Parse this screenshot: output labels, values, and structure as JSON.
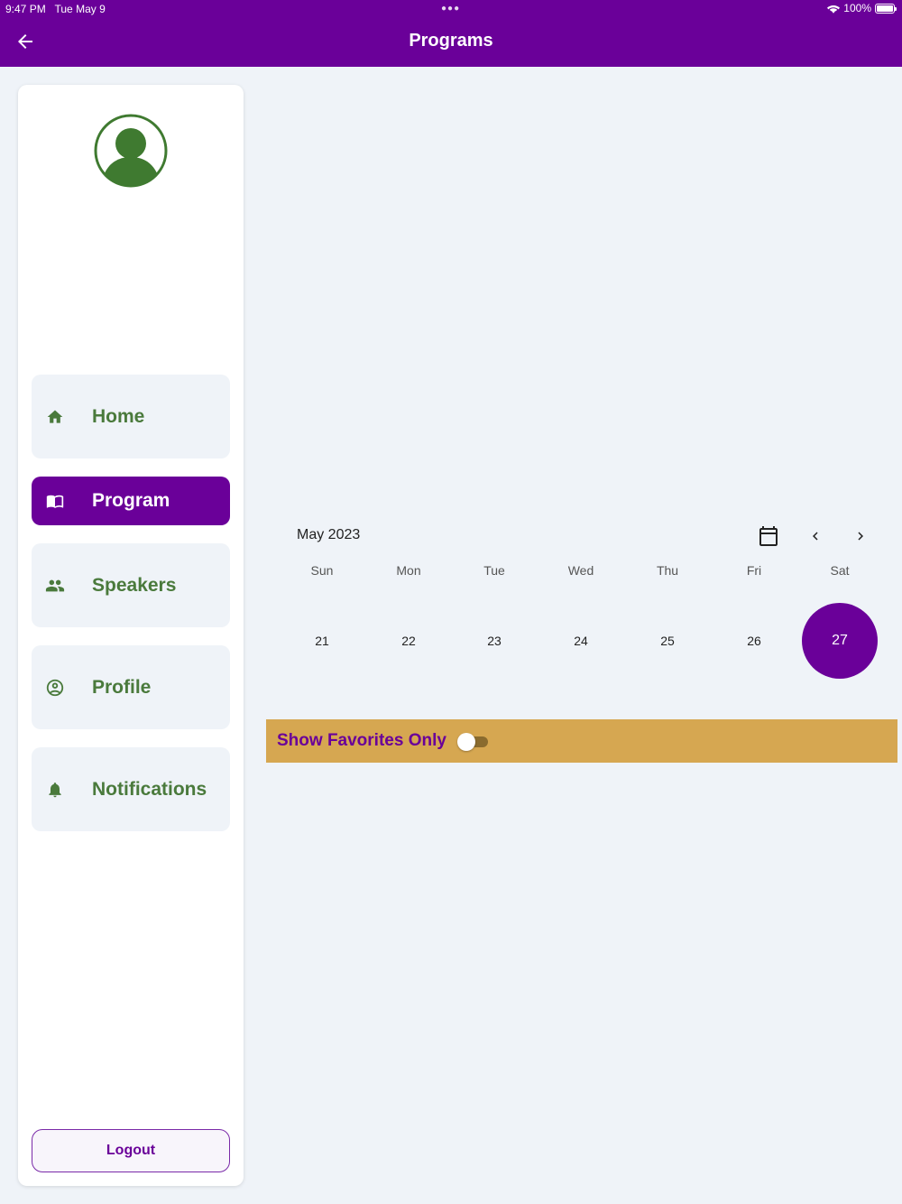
{
  "status_bar": {
    "time": "9:47 PM",
    "date": "Tue May 9",
    "battery": "100%"
  },
  "header": {
    "title": "Programs"
  },
  "colors": {
    "primary": "#6a0099",
    "nav_text": "#4a7a3c",
    "favorites_bar": "#d6a751",
    "background": "#eff3f8"
  },
  "sidebar": {
    "items": [
      {
        "label": "Home",
        "icon": "home-icon",
        "active": false
      },
      {
        "label": "Program",
        "icon": "book-icon",
        "active": true
      },
      {
        "label": "Speakers",
        "icon": "people-icon",
        "active": false
      },
      {
        "label": "Profile",
        "icon": "account-circle-icon",
        "active": false
      },
      {
        "label": "Notifications",
        "icon": "bell-icon",
        "active": false
      }
    ],
    "logout_label": "Logout"
  },
  "calendar": {
    "month_label": "May 2023",
    "weekdays": [
      "Sun",
      "Mon",
      "Tue",
      "Wed",
      "Thu",
      "Fri",
      "Sat"
    ],
    "days": [
      "21",
      "22",
      "23",
      "24",
      "25",
      "26",
      "27"
    ],
    "selected_day": "27"
  },
  "favorites": {
    "label": "Show Favorites Only",
    "enabled": false
  }
}
